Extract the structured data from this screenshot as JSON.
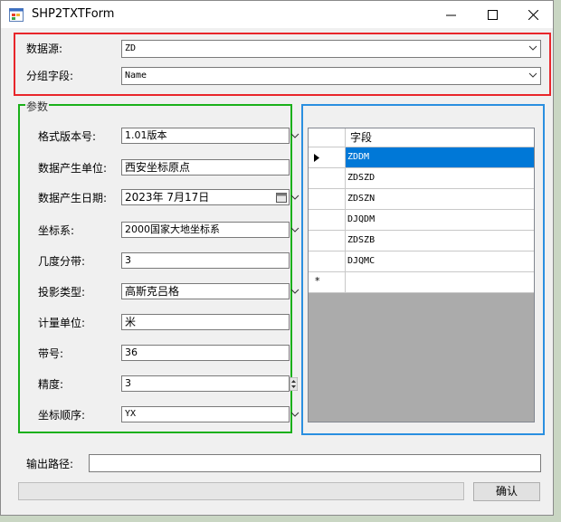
{
  "window": {
    "title": "SHP2TXTForm"
  },
  "source": {
    "datasource_label": "数据源:",
    "datasource_value": "ZD",
    "groupfield_label": "分组字段:",
    "groupfield_value": "Name"
  },
  "params": {
    "group_title": "参数",
    "format_version": {
      "label": "格式版本号:",
      "value": "1.01版本"
    },
    "producer": {
      "label": "数据产生单位:",
      "value": "西安坐标原点"
    },
    "date": {
      "label": "数据产生日期:",
      "value": "2023年 7月17日"
    },
    "crs": {
      "label": "坐标系:",
      "value": "2000国家大地坐标系"
    },
    "zone_width": {
      "label": "几度分带:",
      "value": "3"
    },
    "projection": {
      "label": "投影类型:",
      "value": "高斯克吕格"
    },
    "unit": {
      "label": "计量单位:",
      "value": "米"
    },
    "zone_number": {
      "label": "带号:",
      "value": "36"
    },
    "precision": {
      "label": "精度:",
      "value": "3"
    },
    "coord_order": {
      "label": "坐标顺序:",
      "value": "YX"
    }
  },
  "fields_grid": {
    "column_header": "字段",
    "rows": [
      "ZDDM",
      "ZDSZD",
      "ZDSZN",
      "DJQDM",
      "ZDSZB",
      "DJQMC"
    ],
    "selected_index": 0,
    "new_row_marker": "*"
  },
  "output": {
    "label": "输出路径:",
    "value": ""
  },
  "progress": {
    "value": 0
  },
  "buttons": {
    "confirm": "确认"
  },
  "colors": {
    "source_frame": "#e8262b",
    "params_frame": "#1ab01a",
    "grid_frame": "#2a8fe0",
    "selection": "#0078d7"
  },
  "icons": {
    "app": "app-window-icon",
    "minimize": "minimize-icon",
    "maximize": "maximize-icon",
    "close": "close-icon",
    "dropdown": "chevron-down-icon",
    "calendar": "calendar-icon",
    "spinner": "spinner-arrows-icon",
    "row_pointer": "row-pointer-icon"
  }
}
